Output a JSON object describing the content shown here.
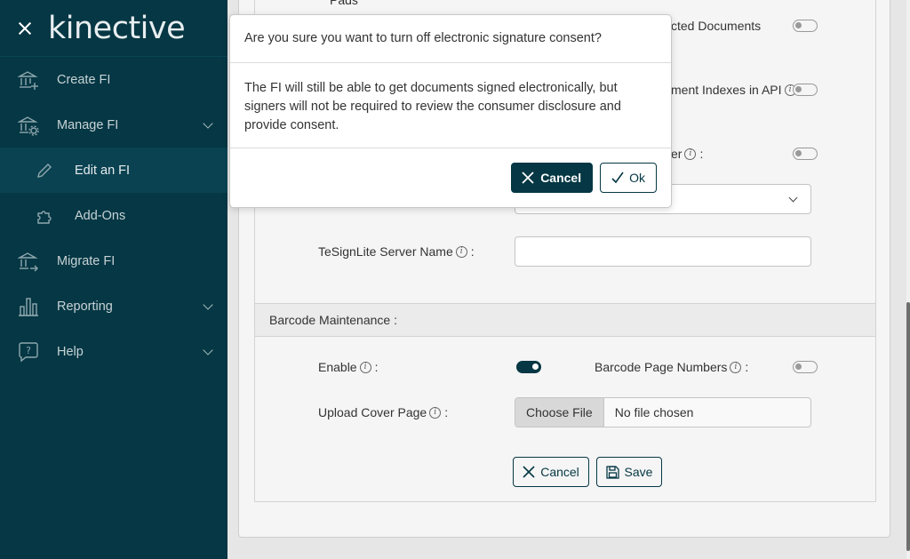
{
  "sidebar": {
    "logo": "kinective",
    "items": [
      {
        "label": "Create FI",
        "icon": "bank-plus-icon"
      },
      {
        "label": "Manage FI",
        "icon": "bank-gear-icon"
      },
      {
        "label": "Edit an FI",
        "icon": "pencil-icon"
      },
      {
        "label": "Add-Ons",
        "icon": "puzzle-icon"
      },
      {
        "label": "Migrate FI",
        "icon": "bank-arrow-icon"
      },
      {
        "label": "Reporting",
        "icon": "bar-chart-icon"
      },
      {
        "label": "Help",
        "icon": "question-bubble-icon"
      }
    ]
  },
  "form": {
    "top_label_partial": "Pads",
    "protected_docs_partial": "cted Documents",
    "indexes_partial": "ment Indexes in API",
    "server_partial": "er",
    "tesign_label": "TeSignLite Server Name",
    "barcode_section": "Barcode Maintenance :",
    "enable_label": "Enable",
    "barcode_page_numbers_label": "Barcode Page Numbers",
    "upload_cover_label": "Upload Cover Page",
    "choose_file": "Choose File",
    "no_file": "No file chosen",
    "cancel_label": "Cancel",
    "save_label": "Save",
    "colon": ":"
  },
  "modal": {
    "title": "Are you sure you want to turn off electronic signature consent?",
    "body": "The FI will still be able to get documents signed electronically, but signers will not be required to review the consumer disclosure and provide consent.",
    "cancel_label": "Cancel",
    "ok_label": "Ok"
  },
  "colors": {
    "sidebar_bg": "#053744",
    "accent": "#053744"
  }
}
